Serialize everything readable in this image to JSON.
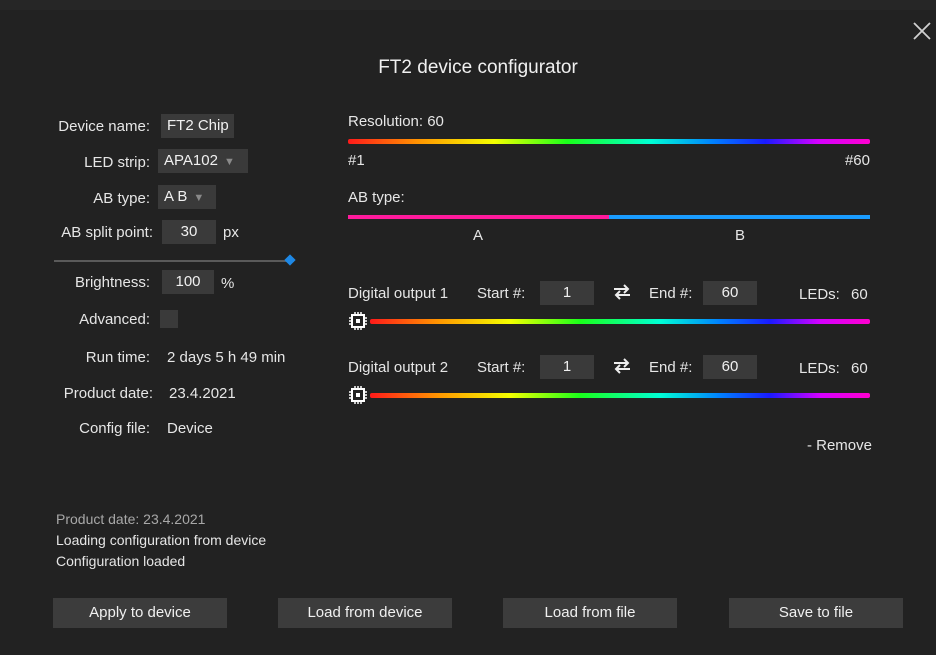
{
  "dialog": {
    "title": "FT2 device configurator"
  },
  "left": {
    "device_name_label": "Device name:",
    "device_name_value": "FT2 Chip",
    "led_strip_label": "LED strip:",
    "led_strip_value": "APA102",
    "ab_type_label": "AB type:",
    "ab_type_value": "A B",
    "ab_split_label": "AB split point:",
    "ab_split_value": "30",
    "ab_split_unit": "px",
    "ab_split_slider_fraction": 1.0,
    "brightness_label": "Brightness:",
    "brightness_value": "100",
    "brightness_unit": "%",
    "advanced_label": "Advanced:",
    "advanced_checked": false,
    "run_time_label": "Run time:",
    "run_time_value": "2 days 5 h 49 min",
    "product_date_label": "Product date:",
    "product_date_value": "23.4.2021",
    "config_file_label": "Config file:",
    "config_file_value": "Device"
  },
  "right": {
    "resolution_label": "Resolution: 60",
    "resolution_start": "#1",
    "resolution_end": "#60",
    "ab_type_label": "AB type:",
    "ab_a_label": "A",
    "ab_b_label": "B",
    "outputs": [
      {
        "label": "Digital output 1",
        "start_label": "Start #:",
        "start_value": "1",
        "end_label": "End #:",
        "end_value": "60",
        "leds_label": "LEDs:",
        "leds_value": "60"
      },
      {
        "label": "Digital output 2",
        "start_label": "Start #:",
        "start_value": "1",
        "end_label": "End #:",
        "end_value": "60",
        "leds_label": "LEDs:",
        "leds_value": "60"
      }
    ],
    "remove_label": "- Remove"
  },
  "log": [
    "Product date: 23.4.2021",
    "Loading configuration from device",
    "Configuration loaded"
  ],
  "buttons": {
    "apply": "Apply to device",
    "load_device": "Load from device",
    "load_file": "Load from file",
    "save_file": "Save to file"
  },
  "colors": {
    "background": "#222222",
    "field": "#3a3a3a",
    "button": "#3c3c3c",
    "ab_a": "#ff1a9c",
    "ab_b": "#1a9cff",
    "slider_accent": "#1e88e5"
  }
}
